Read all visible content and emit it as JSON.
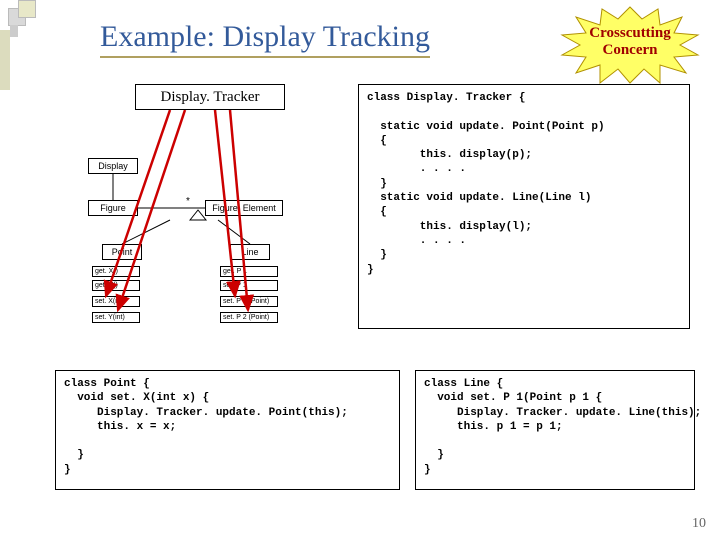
{
  "title": "Example: Display Tracking",
  "starburst": {
    "line1": "Crosscutting",
    "line2": "Concern"
  },
  "dt_label": "Display. Tracker",
  "uml": {
    "display": "Display",
    "figure": "Figure",
    "figelem": "Figure. Element",
    "point": "Point",
    "linecls": "Line",
    "star": "*",
    "m1": "get. X()",
    "m2": "get. Y()",
    "m3": "set. X(int)",
    "m4": "set. Y(int)",
    "m5": "get. P 1",
    "m6": "set. P 1",
    "m7": "set. P 1 (Point)",
    "m8": "set. P 2 (Point)"
  },
  "code_dt": "class Display. Tracker {\n\n  static void update. Point(Point p)\n  {\n        this. display(p);\n        . . . .\n  }\n  static void update. Line(Line l)\n  {\n        this. display(l);\n        . . . .\n  }\n}",
  "code_point": "class Point {\n  void set. X(int x) {\n     Display. Tracker. update. Point(this);\n     this. x = x;\n\n  }\n}",
  "code_line": "class Line {\n  void set. P 1(Point p 1 {\n     Display. Tracker. update. Line(this);\n     this. p 1 = p 1;\n\n  }\n}",
  "page_num": "10"
}
